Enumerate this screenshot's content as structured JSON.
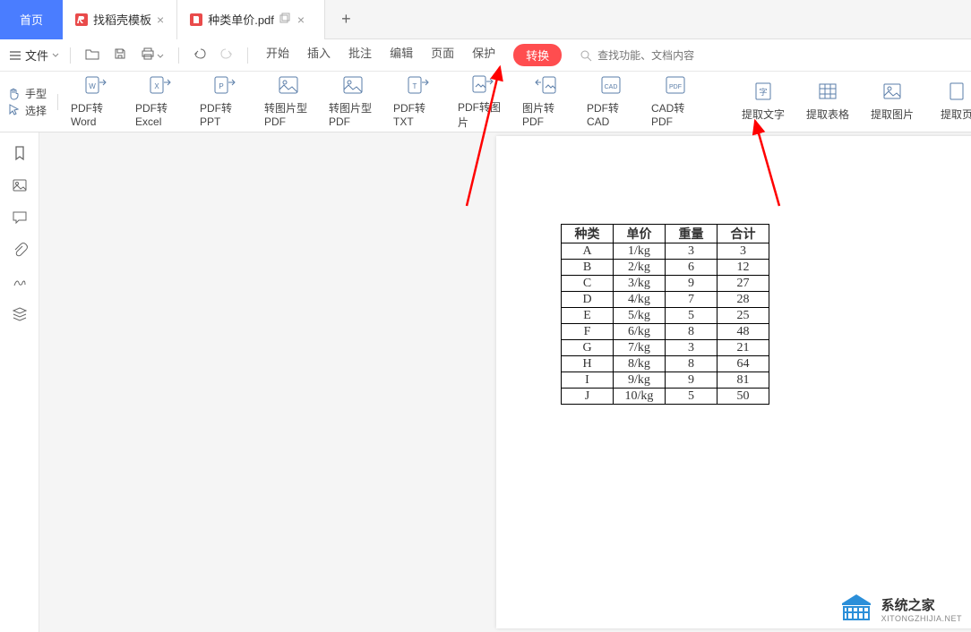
{
  "tabs": {
    "home": "首页",
    "doc1": "找稻壳模板",
    "doc2": "种类单价.pdf"
  },
  "file_menu": "文件",
  "menu": {
    "start": "开始",
    "insert": "插入",
    "comment": "批注",
    "edit": "编辑",
    "page": "页面",
    "protect": "保护",
    "convert": "转换"
  },
  "search": {
    "placeholder": "查找功能、文档内容"
  },
  "tools": {
    "hand": "手型",
    "select": "选择"
  },
  "ribbon": {
    "pdf_word": "PDF转Word",
    "pdf_excel": "PDF转Excel",
    "pdf_ppt": "PDF转PPT",
    "to_img_pdf1": "转图片型PDF",
    "to_img_pdf2": "转图片型PDF",
    "pdf_txt": "PDF转TXT",
    "pdf_img": "PDF转图片",
    "img_pdf": "图片转PDF",
    "pdf_cad": "PDF转CAD",
    "cad_pdf": "CAD转PDF",
    "extract_text": "提取文字",
    "extract_table": "提取表格",
    "extract_img": "提取图片",
    "extract_page": "提取页"
  },
  "chart_data": {
    "type": "table",
    "headers": [
      "种类",
      "单价",
      "重量",
      "合计"
    ],
    "rows": [
      [
        "A",
        "1/kg",
        "3",
        "3"
      ],
      [
        "B",
        "2/kg",
        "6",
        "12"
      ],
      [
        "C",
        "3/kg",
        "9",
        "27"
      ],
      [
        "D",
        "4/kg",
        "7",
        "28"
      ],
      [
        "E",
        "5/kg",
        "5",
        "25"
      ],
      [
        "F",
        "6/kg",
        "8",
        "48"
      ],
      [
        "G",
        "7/kg",
        "3",
        "21"
      ],
      [
        "H",
        "8/kg",
        "8",
        "64"
      ],
      [
        "I",
        "9/kg",
        "9",
        "81"
      ],
      [
        "J",
        "10/kg",
        "5",
        "50"
      ]
    ]
  },
  "watermark": {
    "cn": "系统之家",
    "en": "XITONGZHIJIA.NET"
  }
}
